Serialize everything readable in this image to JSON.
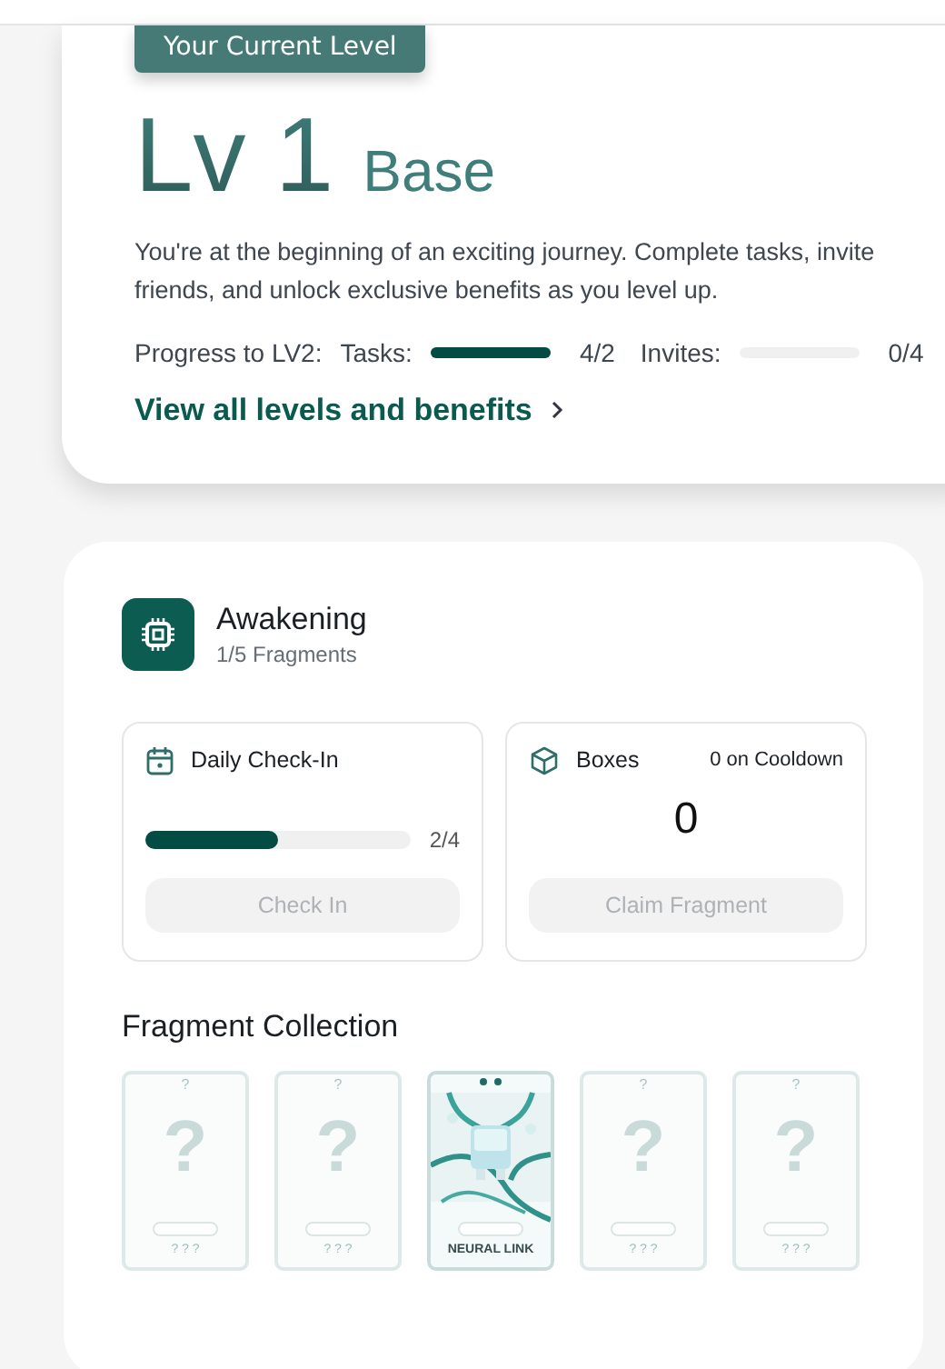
{
  "level_card": {
    "badge": "Your Current Level",
    "level": "Lv 1",
    "tier": "Base",
    "description": "You're at the beginning of an exciting journey. Complete tasks, invite friends, and unlock exclusive benefits as you level up.",
    "progress_label": "Progress to LV2:",
    "progress": [
      {
        "label": "Tasks:",
        "level": 1,
        "reading": "4/2"
      },
      {
        "label": "Invites:",
        "level": 0,
        "reading": "0/4"
      }
    ],
    "link": "View all levels and benefits"
  },
  "stage": {
    "title": "Awakening",
    "subtitle": "1/5 Fragments",
    "check_in": {
      "title": "Daily Check-In",
      "level": 0.5,
      "reading": "2/4",
      "button": "Check In",
      "disabled": true
    },
    "boxes": {
      "title": "Boxes",
      "cooldown": "0 on Cooldown",
      "count": "0",
      "button": "Claim Fragment",
      "disabled": true
    },
    "collection_title": "Fragment Collection",
    "fragments": [
      {
        "collected": false,
        "top": "?",
        "mark": "?",
        "name": "? ? ?"
      },
      {
        "collected": false,
        "top": "?",
        "mark": "?",
        "name": "? ? ?"
      },
      {
        "collected": true,
        "name": "NEURAL LINK"
      },
      {
        "collected": false,
        "top": "?",
        "mark": "?",
        "name": "? ? ?"
      },
      {
        "collected": false,
        "top": "?",
        "mark": "?",
        "name": "? ? ?"
      }
    ]
  }
}
